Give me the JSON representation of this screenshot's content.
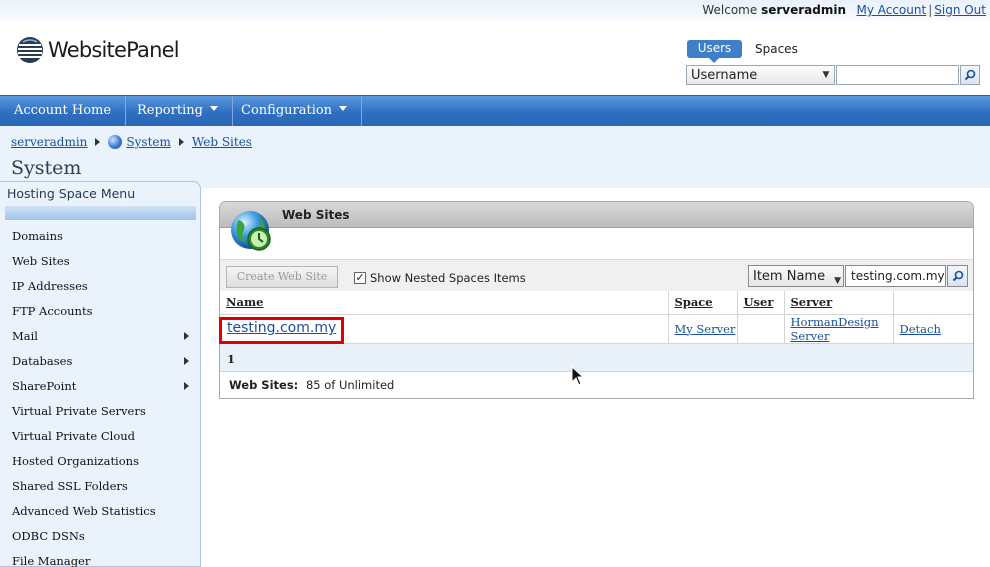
{
  "topbar": {
    "welcome_prefix": "Welcome",
    "username": "serveradmin",
    "my_account": "My Account",
    "separator": "|",
    "sign_out": "Sign Out"
  },
  "logo": {
    "text": "WebsitePanel"
  },
  "search": {
    "tab_users": "Users",
    "tab_spaces": "Spaces",
    "field_value": "Username",
    "input_value": ""
  },
  "nav": {
    "items": [
      {
        "label": "Account Home",
        "has_menu": false
      },
      {
        "label": "Reporting",
        "has_menu": true
      },
      {
        "label": "Configuration",
        "has_menu": true
      }
    ]
  },
  "breadcrumb": {
    "items": [
      "serveradmin",
      "System",
      "Web Sites"
    ]
  },
  "page": {
    "title": "System"
  },
  "sidebar": {
    "title": "Hosting Space Menu",
    "items": [
      {
        "label": "Domains",
        "submenu": false
      },
      {
        "label": "Web Sites",
        "submenu": false
      },
      {
        "label": "IP Addresses",
        "submenu": false
      },
      {
        "label": "FTP Accounts",
        "submenu": false
      },
      {
        "label": "Mail",
        "submenu": true
      },
      {
        "label": "Databases",
        "submenu": true
      },
      {
        "label": "SharePoint",
        "submenu": true
      },
      {
        "label": "Virtual Private Servers",
        "submenu": false
      },
      {
        "label": "Virtual Private Cloud",
        "submenu": false
      },
      {
        "label": "Hosted Organizations",
        "submenu": false
      },
      {
        "label": "Shared SSL Folders",
        "submenu": false
      },
      {
        "label": "Advanced Web Statistics",
        "submenu": false
      },
      {
        "label": "ODBC DSNs",
        "submenu": false
      },
      {
        "label": "File Manager",
        "submenu": false
      }
    ]
  },
  "panel": {
    "title": "Web Sites",
    "create_button": "Create Web Site",
    "nested_label": "Show Nested Spaces Items",
    "nested_checked": true,
    "filter_field": "Item Name",
    "filter_value": "testing.com.my"
  },
  "grid": {
    "columns": [
      "Name",
      "Space",
      "User",
      "Server",
      ""
    ],
    "rows": [
      {
        "name": "testing.com.my",
        "space": "My Server",
        "user": "",
        "server": "HormanDesign Server",
        "action": "Detach"
      }
    ],
    "page": "1"
  },
  "summary": {
    "label": "Web Sites:",
    "value": "85 of Unlimited"
  },
  "colors": {
    "nav_blue": "#2f6fc0",
    "highlight": "#e00000",
    "link": "#1a4fa0"
  }
}
